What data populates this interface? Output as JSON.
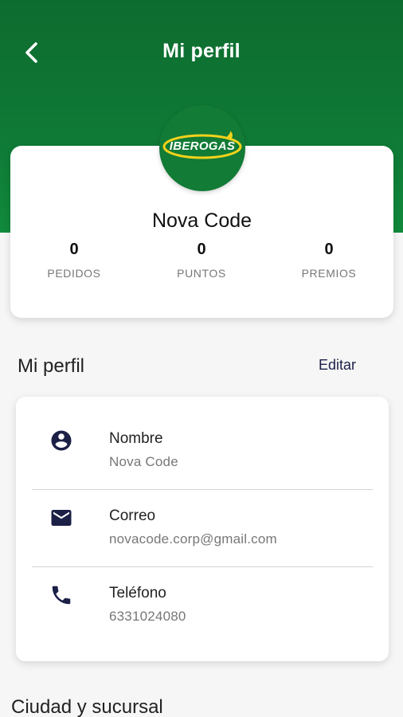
{
  "header": {
    "title": "Mi perfil",
    "background_color": "#0f7a36"
  },
  "logo": {
    "brand": "IBEROGAS",
    "icon": "iberogas-logo"
  },
  "profile": {
    "name": "Nova Code",
    "stats": [
      {
        "value": "0",
        "label": "PEDIDOS"
      },
      {
        "value": "0",
        "label": "PUNTOS"
      },
      {
        "value": "0",
        "label": "PREMIOS"
      }
    ]
  },
  "section": {
    "title": "Mi perfil",
    "edit_label": "Editar"
  },
  "info": [
    {
      "icon": "account-circle-icon",
      "label": "Nombre",
      "value": "Nova Code"
    },
    {
      "icon": "mail-icon",
      "label": "Correo",
      "value": "novacode.corp@gmail.com"
    },
    {
      "icon": "phone-icon",
      "label": "Teléfono",
      "value": "6331024080"
    }
  ],
  "next_section": {
    "title": "Ciudad y sucursal"
  },
  "colors": {
    "primary_green": "#0f7a36",
    "icon_navy": "#1c2047",
    "accent_yellow": "#f2d21b"
  }
}
